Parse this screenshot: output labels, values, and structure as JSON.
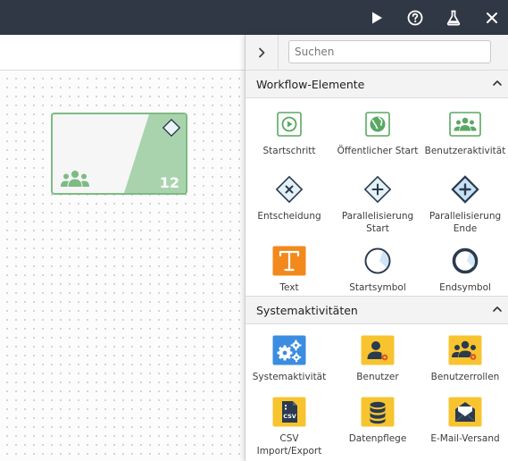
{
  "topbar": {
    "icons": [
      "play-icon",
      "help-icon",
      "flask-icon",
      "close-icon"
    ]
  },
  "node": {
    "count": "12",
    "icons": [
      "diamond-icon",
      "people-icon"
    ],
    "color": "#7dbb83"
  },
  "panel": {
    "search": {
      "placeholder": "Suchen",
      "value": ""
    },
    "sections": [
      {
        "title": "Workflow-Elemente",
        "items": [
          {
            "label": "Startschritt",
            "icon": "play-circle-icon"
          },
          {
            "label": "Öffentlicher Start",
            "icon": "globe-icon"
          },
          {
            "label": "Benutzeraktivität",
            "icon": "people-icon"
          },
          {
            "label": "Entscheidung",
            "icon": "decision-x-icon"
          },
          {
            "label": "Parallelisierung Start",
            "icon": "parallel-plus-icon"
          },
          {
            "label": "Parallelisierung Ende",
            "icon": "parallel-plus-filled-icon"
          },
          {
            "label": "Text",
            "icon": "text-t-icon"
          },
          {
            "label": "Startsymbol",
            "icon": "start-circle-icon"
          },
          {
            "label": "Endsymbol",
            "icon": "end-circle-icon"
          }
        ]
      },
      {
        "title": "Systemaktivitäten",
        "items": [
          {
            "label": "Systemaktivität",
            "icon": "gears-icon"
          },
          {
            "label": "Benutzer",
            "icon": "user-gear-icon"
          },
          {
            "label": "Benutzerrollen",
            "icon": "users-gear-icon"
          },
          {
            "label": "CSV Import/Export",
            "icon": "csv-file-icon"
          },
          {
            "label": "Datenpflege",
            "icon": "database-icon"
          },
          {
            "label": "E-Mail-Versand",
            "icon": "email-icon"
          }
        ]
      }
    ]
  },
  "colors": {
    "topbar": "#313845",
    "green": "#5aa862",
    "blue": "#3b8de0",
    "orange": "#f2891c",
    "yellow": "#f7c430",
    "navy": "#2b3a4e"
  }
}
